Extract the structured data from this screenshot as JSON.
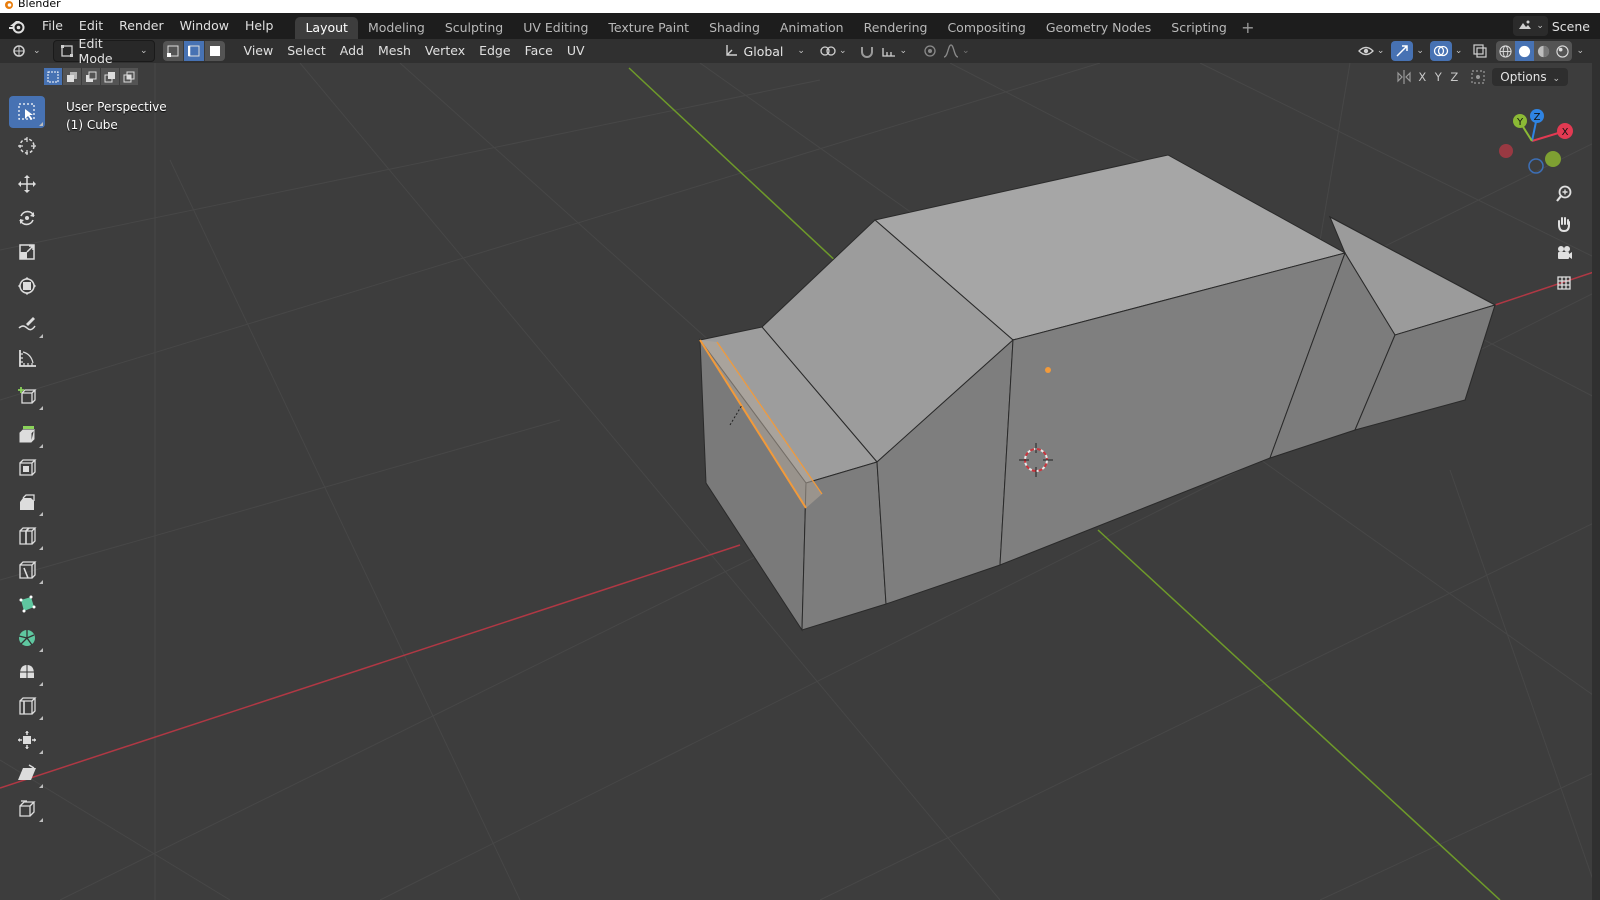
{
  "os_window": {
    "title": "Blender"
  },
  "topbar": {
    "menus": [
      "File",
      "Edit",
      "Render",
      "Window",
      "Help"
    ],
    "workspaces": [
      "Layout",
      "Modeling",
      "Sculpting",
      "UV Editing",
      "Texture Paint",
      "Shading",
      "Animation",
      "Rendering",
      "Compositing",
      "Geometry Nodes",
      "Scripting"
    ],
    "active_workspace": "Layout",
    "add_workspace": "+",
    "scene_label": "Scene"
  },
  "viewport_header": {
    "mode": "Edit Mode",
    "menus": [
      "View",
      "Select",
      "Add",
      "Mesh",
      "Vertex",
      "Edge",
      "Face",
      "UV"
    ],
    "transform_orientation": "Global",
    "select_mode_active": "edge",
    "options_label": "Options",
    "axes": [
      "X",
      "Y",
      "Z"
    ]
  },
  "overlay": {
    "view_name": "User Perspective",
    "object_name": "(1) Cube"
  },
  "gizmo": {
    "x_label": "X",
    "y_label": "Y",
    "z_label": "Z",
    "x_color": "#e23a52",
    "y_color": "#8bb935",
    "z_color": "#2f84e3"
  },
  "toolbar": {
    "tools": [
      "select-box",
      "cursor",
      "move",
      "rotate",
      "scale",
      "transform",
      "annotate",
      "measure",
      "add-cube",
      "extrude-region",
      "inset-faces",
      "bevel",
      "loop-cut",
      "knife",
      "poly-build",
      "spin",
      "smooth",
      "edge-slide",
      "shrink-fatten",
      "shear",
      "rip-region"
    ],
    "active_tool": "select-box"
  },
  "colors": {
    "selection": "#f29a3a",
    "active": "#4772b3",
    "x_axis": "#b03844",
    "y_axis": "#6e9a2a"
  }
}
